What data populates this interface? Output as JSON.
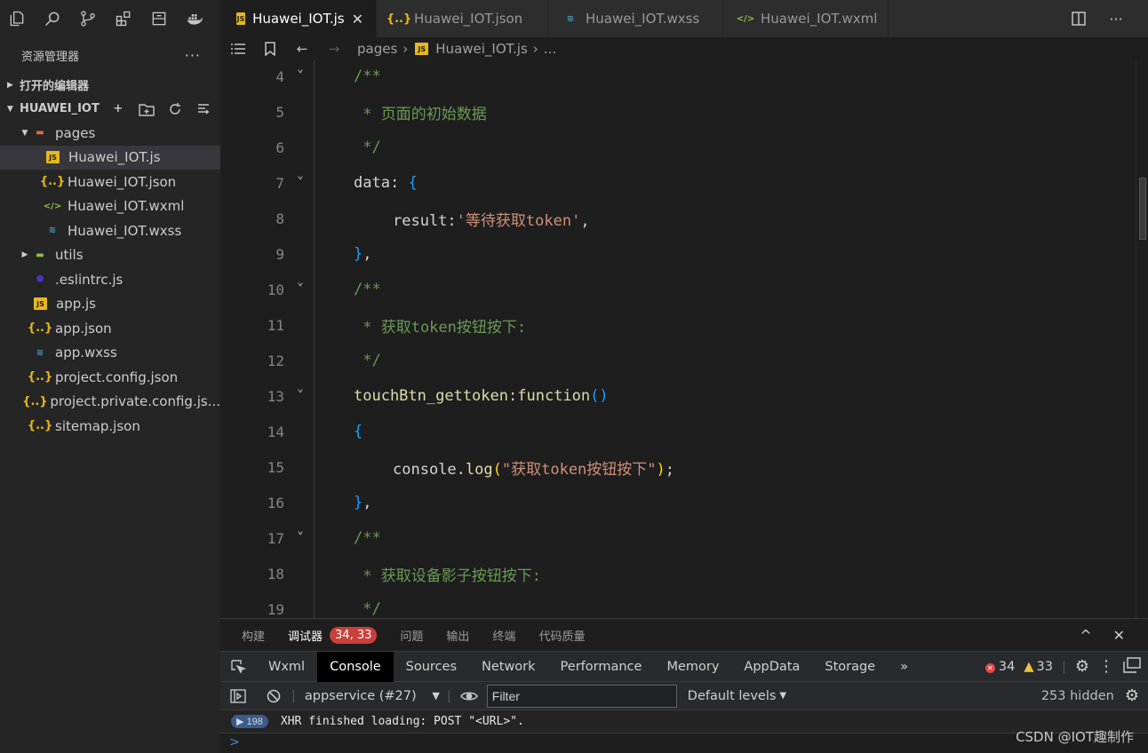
{
  "sidebar": {
    "title": "资源管理器",
    "more": "···",
    "open_editors": "打开的编辑器",
    "project": "HUAWEI_IOT",
    "tree": [
      {
        "label": "pages",
        "type": "folder-red",
        "depth": 1,
        "expanded": true
      },
      {
        "label": "Huawei_IOT.js",
        "type": "js",
        "depth": 2,
        "selected": true
      },
      {
        "label": "Huawei_IOT.json",
        "type": "json",
        "depth": 2
      },
      {
        "label": "Huawei_IOT.wxml",
        "type": "wxml",
        "depth": 2
      },
      {
        "label": "Huawei_IOT.wxss",
        "type": "wxss",
        "depth": 2
      },
      {
        "label": "utils",
        "type": "folder-green",
        "depth": 1,
        "expanded": false
      },
      {
        "label": ".eslintrc.js",
        "type": "eslint",
        "depth": 1
      },
      {
        "label": "app.js",
        "type": "js",
        "depth": 1
      },
      {
        "label": "app.json",
        "type": "json",
        "depth": 1
      },
      {
        "label": "app.wxss",
        "type": "wxss",
        "depth": 1
      },
      {
        "label": "project.config.json",
        "type": "json",
        "depth": 1
      },
      {
        "label": "project.private.config.js...",
        "type": "json",
        "depth": 1
      },
      {
        "label": "sitemap.json",
        "type": "json",
        "depth": 1
      }
    ]
  },
  "tabs": [
    {
      "label": "Huawei_IOT.js",
      "type": "js",
      "active": true,
      "close": "✕"
    },
    {
      "label": "Huawei_IOT.json",
      "type": "json"
    },
    {
      "label": "Huawei_IOT.wxss",
      "type": "wxss"
    },
    {
      "label": "Huawei_IOT.wxml",
      "type": "wxml"
    }
  ],
  "breadcrumb": {
    "folder": "pages",
    "file": "Huawei_IOT.js",
    "rest": "..."
  },
  "code": [
    {
      "n": "4",
      "fold": true,
      "text": "/**",
      "cls": "c-comment",
      "indent": 0
    },
    {
      "n": "5",
      "text": " * 页面的初始数据",
      "cls": "c-comment",
      "indent": 0
    },
    {
      "n": "6",
      "text": " */",
      "cls": "c-comment",
      "indent": 0
    },
    {
      "n": "7",
      "fold": true,
      "parts": [
        [
          "data",
          "c-prop"
        ],
        [
          ": ",
          "c-punc"
        ],
        [
          "{",
          "c-blue-brace"
        ]
      ],
      "indent": 0
    },
    {
      "n": "8",
      "parts": [
        [
          "result",
          "c-prop"
        ],
        [
          ":",
          "c-punc"
        ],
        [
          "'等待获取token'",
          "c-str"
        ],
        [
          ",",
          "c-punc"
        ]
      ],
      "indent": 1
    },
    {
      "n": "9",
      "parts": [
        [
          "}",
          "c-blue-brace"
        ],
        [
          ",",
          "c-punc"
        ]
      ],
      "indent": 0
    },
    {
      "n": "10",
      "fold": true,
      "text": "/**",
      "cls": "c-comment",
      "indent": 0
    },
    {
      "n": "11",
      "text": " * 获取token按钮按下:",
      "cls": "c-comment",
      "indent": 0
    },
    {
      "n": "12",
      "text": " */",
      "cls": "c-comment",
      "indent": 0
    },
    {
      "n": "13",
      "fold": true,
      "parts": [
        [
          "touchBtn_gettoken",
          "c-fn"
        ],
        [
          ":",
          "c-punc"
        ],
        [
          "function",
          "c-fn"
        ],
        [
          "()",
          "c-blue-brace"
        ]
      ],
      "indent": 0
    },
    {
      "n": "14",
      "parts": [
        [
          "{",
          "c-blue-brace"
        ]
      ],
      "indent": 0
    },
    {
      "n": "15",
      "parts": [
        [
          "console",
          "c-prop"
        ],
        [
          ".",
          "c-punc"
        ],
        [
          "log",
          "c-fn"
        ],
        [
          "(",
          "c-brace"
        ],
        [
          "\"获取token按钮按下\"",
          "c-str"
        ],
        [
          ")",
          "c-brace"
        ],
        [
          ";",
          "c-punc"
        ]
      ],
      "indent": 1
    },
    {
      "n": "16",
      "parts": [
        [
          "}",
          "c-blue-brace"
        ],
        [
          ",",
          "c-punc"
        ]
      ],
      "indent": 0
    },
    {
      "n": "17",
      "fold": true,
      "text": "/**",
      "cls": "c-comment",
      "indent": 0
    },
    {
      "n": "18",
      "text": " * 获取设备影子按钮按下:",
      "cls": "c-comment",
      "indent": 0
    },
    {
      "n": "19",
      "text": " */",
      "cls": "c-comment",
      "indent": 0
    }
  ],
  "panel": {
    "tabs": [
      "构建",
      "调试器",
      "问题",
      "输出",
      "终端",
      "代码质量"
    ],
    "active": "调试器",
    "badge": "34, 33",
    "collapse": "^",
    "close": "✕"
  },
  "devtools": {
    "tabs": [
      "Wxml",
      "Console",
      "Sources",
      "Network",
      "Performance",
      "Memory",
      "AppData",
      "Storage"
    ],
    "active": "Console",
    "more": "»",
    "errors": "34",
    "warnings": "33",
    "context": "appservice (#27)",
    "filter_placeholder": "Filter",
    "levels": "Default levels",
    "hidden": "253 hidden",
    "log_count": "198",
    "log_text": "XHR finished loading: POST \"<URL>\".",
    "prompt": ">"
  },
  "watermark": "CSDN @IOT趣制作"
}
